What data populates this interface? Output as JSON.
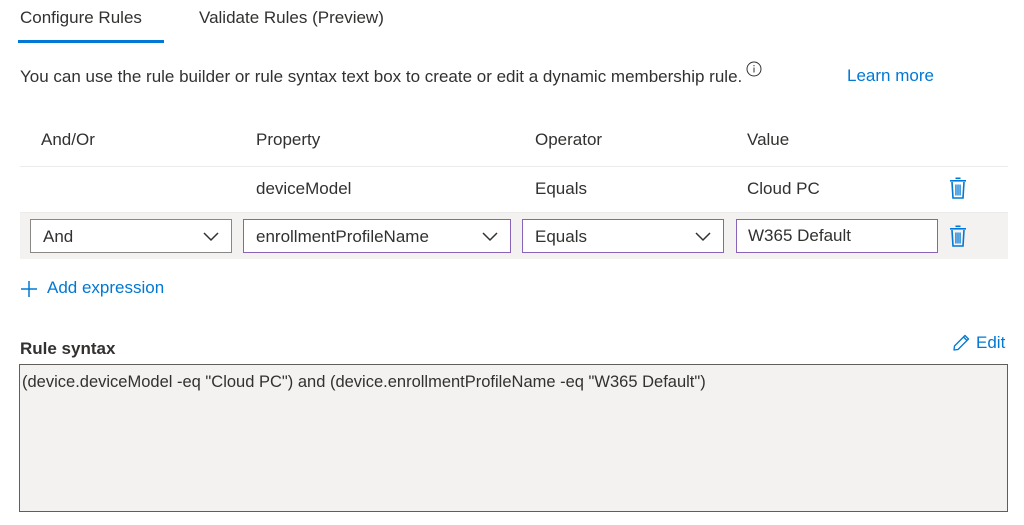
{
  "tabs": {
    "configure": "Configure Rules",
    "validate": "Validate Rules (Preview)"
  },
  "description": {
    "text": "You can use the rule builder or rule syntax text box to create or edit a dynamic membership rule.",
    "learn_more": "Learn more"
  },
  "table": {
    "headers": {
      "and_or": "And/Or",
      "property": "Property",
      "operator": "Operator",
      "value": "Value"
    },
    "rows": [
      {
        "and_or": "",
        "property": "deviceModel",
        "operator": "Equals",
        "value": "Cloud PC"
      },
      {
        "and_or": "And",
        "property": "enrollmentProfileName",
        "operator": "Equals",
        "value": "W365 Default"
      }
    ]
  },
  "add_expression": "Add expression",
  "rule_syntax": {
    "label": "Rule syntax",
    "edit": "Edit",
    "text": "(device.deviceModel -eq \"Cloud PC\") and (device.enrollmentProfileName -eq \"W365 Default\")"
  },
  "icons": {
    "info": "info-icon",
    "delete": "trash-icon",
    "dropdown": "chevron-down-icon",
    "add": "plus-icon",
    "edit": "pencil-icon"
  },
  "colors": {
    "accent": "#0078d4",
    "focus_border": "#8764b8",
    "row_highlight": "#f3f2f1"
  }
}
